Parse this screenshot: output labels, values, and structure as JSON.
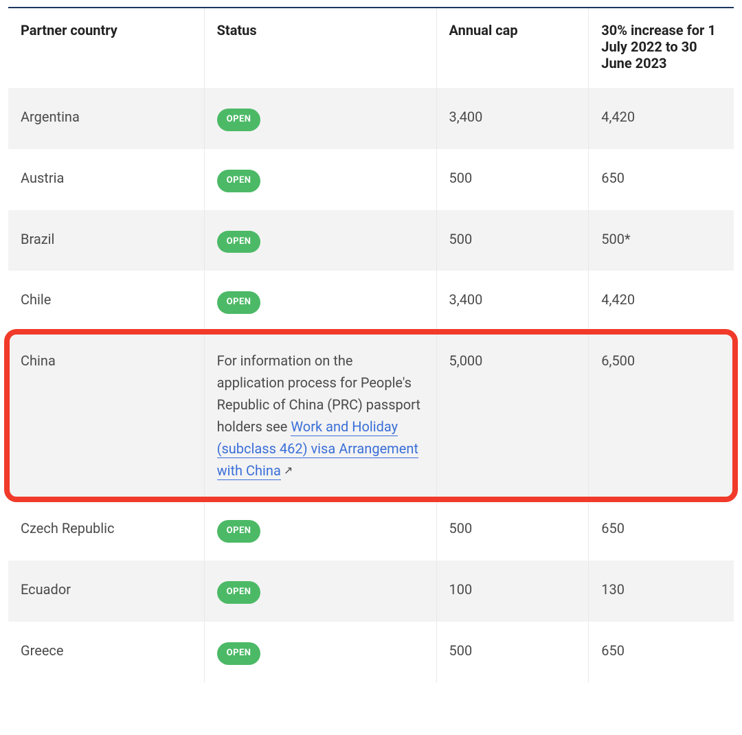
{
  "headers": {
    "country": "Partner country",
    "status": "Status",
    "cap": "Annual cap",
    "increase": "30% increase for 1 July 2022 to 30 June 2023"
  },
  "badge_label": "OPEN",
  "rows": [
    {
      "country": "Argentina",
      "status_type": "badge",
      "cap": "3,400",
      "increase": "4,420"
    },
    {
      "country": "Austria",
      "status_type": "badge",
      "cap": "500",
      "increase": "650"
    },
    {
      "country": "Brazil",
      "status_type": "badge",
      "cap": "500",
      "increase": "500*"
    },
    {
      "country": "Chile",
      "status_type": "badge",
      "cap": "3,400",
      "increase": "4,420"
    },
    {
      "country": "China",
      "status_type": "text",
      "status_text_prefix": "For information on the application process for People's Republic of China (PRC) passport holders see ",
      "status_link_text": "Work and Holiday (subclass 462) visa Arrangement with China",
      "cap": "5,000",
      "increase": "6,500",
      "highlight": true
    },
    {
      "country": "Czech Republic",
      "status_type": "badge",
      "cap": "500",
      "increase": "650"
    },
    {
      "country": "Ecuador",
      "status_type": "badge",
      "cap": "100",
      "increase": "130"
    },
    {
      "country": "Greece",
      "status_type": "badge",
      "cap": "500",
      "increase": "650"
    }
  ]
}
